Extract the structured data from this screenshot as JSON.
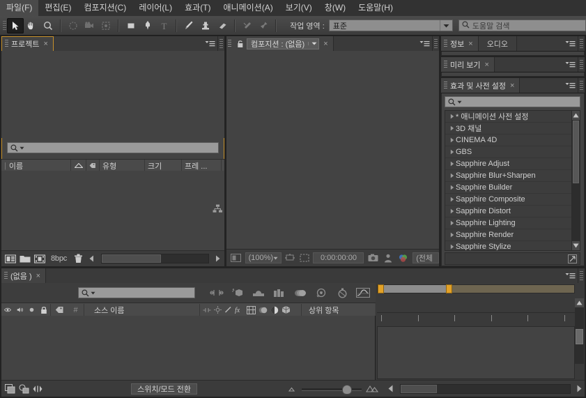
{
  "app": {
    "title": "Adobe After Effects",
    "theme_bg": "#434343",
    "accent": "#c8922a"
  },
  "menubar": {
    "items": [
      {
        "label": "파일(F)",
        "name": "menu-file"
      },
      {
        "label": "편집(E)",
        "name": "menu-edit"
      },
      {
        "label": "컴포지션(C)",
        "name": "menu-composition"
      },
      {
        "label": "레이어(L)",
        "name": "menu-layer"
      },
      {
        "label": "효과(T)",
        "name": "menu-effect"
      },
      {
        "label": "애니메이션(A)",
        "name": "menu-animation"
      },
      {
        "label": "보기(V)",
        "name": "menu-view"
      },
      {
        "label": "창(W)",
        "name": "menu-window"
      },
      {
        "label": "도움말(H)",
        "name": "menu-help"
      }
    ]
  },
  "toolbar": {
    "tools": [
      {
        "icon": "selection-arrow-icon",
        "active": true
      },
      {
        "icon": "hand-icon",
        "active": false
      },
      {
        "icon": "zoom-magnifier-icon",
        "active": false
      },
      {
        "icon": "orbit-rotate-icon",
        "active": false
      },
      {
        "icon": "camera-icon",
        "active": false
      },
      {
        "icon": "pan-behind-icon",
        "active": false
      },
      {
        "icon": "rectangle-shape-icon",
        "active": false
      },
      {
        "icon": "pen-icon",
        "active": false
      },
      {
        "icon": "type-text-icon",
        "active": false
      },
      {
        "icon": "brush-icon",
        "active": false
      },
      {
        "icon": "clone-stamp-icon",
        "active": false
      },
      {
        "icon": "eraser-icon",
        "active": false
      },
      {
        "icon": "roto-brush-icon",
        "active": false
      },
      {
        "icon": "puppet-pin-icon",
        "active": false
      }
    ],
    "workspace_label": "작업 영역 :",
    "workspace_value": "표준",
    "help_search_placeholder": "도움말 검색"
  },
  "project_panel": {
    "tab_label": "프로젝트",
    "tab_close": "×",
    "search_placeholder": "",
    "columns": [
      {
        "label": "이름",
        "name": "column-name"
      },
      {
        "label": "",
        "name": "column-sort-arrow"
      },
      {
        "label": "",
        "name": "column-label-tag"
      },
      {
        "label": "유형",
        "name": "column-type"
      },
      {
        "label": "크기",
        "name": "column-size"
      },
      {
        "label": "프레 ...",
        "name": "column-framerate"
      }
    ],
    "rows": [],
    "footer": {
      "bit_depth": "8bpc",
      "buttons": [
        {
          "icon": "new-composition-icon"
        },
        {
          "icon": "new-folder-icon"
        },
        {
          "icon": "interpret-footage-icon"
        },
        {
          "icon": "delete-trash-icon"
        }
      ]
    }
  },
  "comp_panel": {
    "tab_label": "컴포지션 : (없음)",
    "tab_close": "×",
    "lock_icon": "lock-icon",
    "footer": {
      "region_icon": "region-of-interest-icon",
      "magnification": "(100%)",
      "timecode": "0:00:00:00",
      "resolution": "(전체",
      "buttons": [
        {
          "icon": "snapshot-camera-icon"
        },
        {
          "icon": "show-snapshot-icon"
        },
        {
          "icon": "channel-rgb-icon"
        }
      ]
    }
  },
  "info_panel": {
    "tabs": [
      {
        "label": "정보",
        "active": true,
        "close": "×"
      },
      {
        "label": "오디오",
        "active": false
      }
    ]
  },
  "preview_panel": {
    "tabs": [
      {
        "label": "미리 보기",
        "active": true,
        "close": "×"
      }
    ]
  },
  "effects_panel": {
    "tab_label": "효과 및 사전 설정",
    "tab_close": "×",
    "search_placeholder": "",
    "items": [
      {
        "label": "* 애니메이션 사전 설정"
      },
      {
        "label": "3D 채널"
      },
      {
        "label": "CINEMA 4D"
      },
      {
        "label": "GBS"
      },
      {
        "label": "Sapphire Adjust"
      },
      {
        "label": "Sapphire Blur+Sharpen"
      },
      {
        "label": "Sapphire Builder"
      },
      {
        "label": "Sapphire Composite"
      },
      {
        "label": "Sapphire Distort"
      },
      {
        "label": "Sapphire Lighting"
      },
      {
        "label": "Sapphire Render"
      },
      {
        "label": "Sapphire Stylize"
      }
    ]
  },
  "timeline_panel": {
    "tab_label": "(없음 )",
    "tab_close": "×",
    "search_placeholder": "",
    "tools": [
      {
        "icon": "live-update-icon"
      },
      {
        "icon": "draft-3d-icon"
      },
      {
        "icon": "hide-shy-layers-icon"
      },
      {
        "icon": "frame-blending-icon"
      },
      {
        "icon": "motion-blur-icon"
      },
      {
        "icon": "brainstorm-icon"
      },
      {
        "icon": "auto-keyframe-icon"
      },
      {
        "icon": "graph-editor-icon"
      }
    ],
    "columns": [
      {
        "label": "",
        "name": "column-video-eye"
      },
      {
        "label": "",
        "name": "column-audio-speaker"
      },
      {
        "label": "",
        "name": "column-solo"
      },
      {
        "label": "",
        "name": "column-lock"
      },
      {
        "label": "",
        "name": "column-label-tag"
      },
      {
        "label": "#",
        "name": "column-number"
      },
      {
        "label": "소스 이름",
        "name": "column-source-name"
      },
      {
        "label": "상위 항목",
        "name": "column-parent"
      }
    ],
    "switch_icons": [
      {
        "icon": "shy-icon"
      },
      {
        "icon": "collapse-transformations-icon"
      },
      {
        "icon": "quality-icon"
      },
      {
        "icon": "effects-fx-icon"
      },
      {
        "icon": "frame-blend-icon"
      },
      {
        "icon": "motion-blur-switch-icon"
      },
      {
        "icon": "adjustment-layer-icon"
      },
      {
        "icon": "three-d-layer-icon"
      }
    ],
    "rows": [],
    "footer": {
      "toggle_label": "스위치/모드 전환",
      "buttons": [
        {
          "icon": "comp-flowchart-icon"
        },
        {
          "icon": "comp-mini-flowchart-icon"
        },
        {
          "icon": "expand-collapse-icon"
        }
      ],
      "zoom_small_icon": "zoom-out-mountain-icon",
      "zoom_large_icon": "zoom-in-mountain-icon"
    },
    "ruler_ticks": 6,
    "work_area": {
      "start_pct": 0,
      "end_pct": 36
    }
  }
}
